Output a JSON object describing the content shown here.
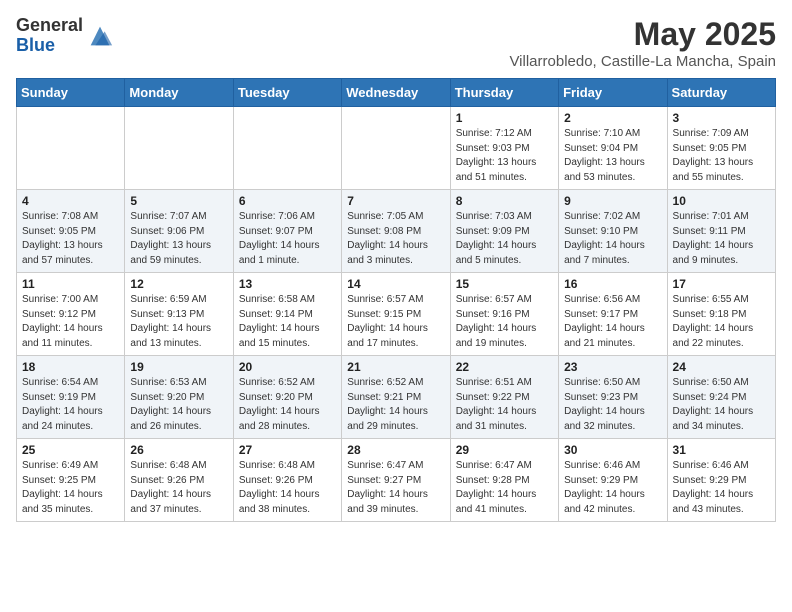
{
  "header": {
    "logo_general": "General",
    "logo_blue": "Blue",
    "title": "May 2025",
    "location": "Villarrobledo, Castille-La Mancha, Spain"
  },
  "weekdays": [
    "Sunday",
    "Monday",
    "Tuesday",
    "Wednesday",
    "Thursday",
    "Friday",
    "Saturday"
  ],
  "weeks": [
    [
      {
        "day": "",
        "info": ""
      },
      {
        "day": "",
        "info": ""
      },
      {
        "day": "",
        "info": ""
      },
      {
        "day": "",
        "info": ""
      },
      {
        "day": "1",
        "info": "Sunrise: 7:12 AM\nSunset: 9:03 PM\nDaylight: 13 hours\nand 51 minutes."
      },
      {
        "day": "2",
        "info": "Sunrise: 7:10 AM\nSunset: 9:04 PM\nDaylight: 13 hours\nand 53 minutes."
      },
      {
        "day": "3",
        "info": "Sunrise: 7:09 AM\nSunset: 9:05 PM\nDaylight: 13 hours\nand 55 minutes."
      }
    ],
    [
      {
        "day": "4",
        "info": "Sunrise: 7:08 AM\nSunset: 9:05 PM\nDaylight: 13 hours\nand 57 minutes."
      },
      {
        "day": "5",
        "info": "Sunrise: 7:07 AM\nSunset: 9:06 PM\nDaylight: 13 hours\nand 59 minutes."
      },
      {
        "day": "6",
        "info": "Sunrise: 7:06 AM\nSunset: 9:07 PM\nDaylight: 14 hours\nand 1 minute."
      },
      {
        "day": "7",
        "info": "Sunrise: 7:05 AM\nSunset: 9:08 PM\nDaylight: 14 hours\nand 3 minutes."
      },
      {
        "day": "8",
        "info": "Sunrise: 7:03 AM\nSunset: 9:09 PM\nDaylight: 14 hours\nand 5 minutes."
      },
      {
        "day": "9",
        "info": "Sunrise: 7:02 AM\nSunset: 9:10 PM\nDaylight: 14 hours\nand 7 minutes."
      },
      {
        "day": "10",
        "info": "Sunrise: 7:01 AM\nSunset: 9:11 PM\nDaylight: 14 hours\nand 9 minutes."
      }
    ],
    [
      {
        "day": "11",
        "info": "Sunrise: 7:00 AM\nSunset: 9:12 PM\nDaylight: 14 hours\nand 11 minutes."
      },
      {
        "day": "12",
        "info": "Sunrise: 6:59 AM\nSunset: 9:13 PM\nDaylight: 14 hours\nand 13 minutes."
      },
      {
        "day": "13",
        "info": "Sunrise: 6:58 AM\nSunset: 9:14 PM\nDaylight: 14 hours\nand 15 minutes."
      },
      {
        "day": "14",
        "info": "Sunrise: 6:57 AM\nSunset: 9:15 PM\nDaylight: 14 hours\nand 17 minutes."
      },
      {
        "day": "15",
        "info": "Sunrise: 6:57 AM\nSunset: 9:16 PM\nDaylight: 14 hours\nand 19 minutes."
      },
      {
        "day": "16",
        "info": "Sunrise: 6:56 AM\nSunset: 9:17 PM\nDaylight: 14 hours\nand 21 minutes."
      },
      {
        "day": "17",
        "info": "Sunrise: 6:55 AM\nSunset: 9:18 PM\nDaylight: 14 hours\nand 22 minutes."
      }
    ],
    [
      {
        "day": "18",
        "info": "Sunrise: 6:54 AM\nSunset: 9:19 PM\nDaylight: 14 hours\nand 24 minutes."
      },
      {
        "day": "19",
        "info": "Sunrise: 6:53 AM\nSunset: 9:20 PM\nDaylight: 14 hours\nand 26 minutes."
      },
      {
        "day": "20",
        "info": "Sunrise: 6:52 AM\nSunset: 9:20 PM\nDaylight: 14 hours\nand 28 minutes."
      },
      {
        "day": "21",
        "info": "Sunrise: 6:52 AM\nSunset: 9:21 PM\nDaylight: 14 hours\nand 29 minutes."
      },
      {
        "day": "22",
        "info": "Sunrise: 6:51 AM\nSunset: 9:22 PM\nDaylight: 14 hours\nand 31 minutes."
      },
      {
        "day": "23",
        "info": "Sunrise: 6:50 AM\nSunset: 9:23 PM\nDaylight: 14 hours\nand 32 minutes."
      },
      {
        "day": "24",
        "info": "Sunrise: 6:50 AM\nSunset: 9:24 PM\nDaylight: 14 hours\nand 34 minutes."
      }
    ],
    [
      {
        "day": "25",
        "info": "Sunrise: 6:49 AM\nSunset: 9:25 PM\nDaylight: 14 hours\nand 35 minutes."
      },
      {
        "day": "26",
        "info": "Sunrise: 6:48 AM\nSunset: 9:26 PM\nDaylight: 14 hours\nand 37 minutes."
      },
      {
        "day": "27",
        "info": "Sunrise: 6:48 AM\nSunset: 9:26 PM\nDaylight: 14 hours\nand 38 minutes."
      },
      {
        "day": "28",
        "info": "Sunrise: 6:47 AM\nSunset: 9:27 PM\nDaylight: 14 hours\nand 39 minutes."
      },
      {
        "day": "29",
        "info": "Sunrise: 6:47 AM\nSunset: 9:28 PM\nDaylight: 14 hours\nand 41 minutes."
      },
      {
        "day": "30",
        "info": "Sunrise: 6:46 AM\nSunset: 9:29 PM\nDaylight: 14 hours\nand 42 minutes."
      },
      {
        "day": "31",
        "info": "Sunrise: 6:46 AM\nSunset: 9:29 PM\nDaylight: 14 hours\nand 43 minutes."
      }
    ]
  ]
}
